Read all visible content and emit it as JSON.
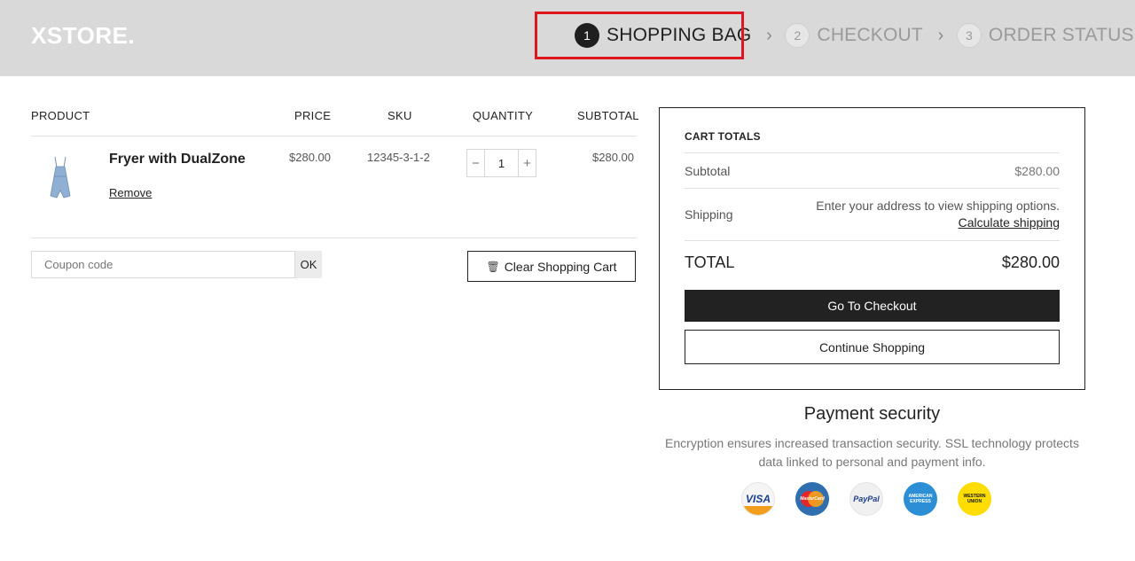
{
  "brand": {
    "logo": "XSTORE."
  },
  "steps": [
    {
      "num": "1",
      "label": "SHOPPING BAG",
      "active": true
    },
    {
      "num": "2",
      "label": "CHECKOUT",
      "active": false
    },
    {
      "num": "3",
      "label": "ORDER STATUS",
      "active": false
    }
  ],
  "cart": {
    "columns": {
      "product": "PRODUCT",
      "price": "PRICE",
      "sku": "SKU",
      "quantity": "QUANTITY",
      "subtotal": "SUBTOTAL"
    },
    "items": [
      {
        "name": "Fryer with DualZone",
        "remove": "Remove",
        "price": "$280.00",
        "sku": "12345-3-1-2",
        "quantity": "1",
        "subtotal": "$280.00"
      }
    ],
    "coupon_placeholder": "Coupon code",
    "coupon_ok": "OK",
    "clear_label": "Clear Shopping Cart"
  },
  "totals": {
    "title": "CART TOTALS",
    "subtotal_label": "Subtotal",
    "subtotal_value": "$280.00",
    "shipping_label": "Shipping",
    "shipping_note": "Enter your address to view shipping options.",
    "calculate_shipping": "Calculate shipping",
    "total_label": "TOTAL",
    "total_value": "$280.00",
    "checkout_label": "Go To Checkout",
    "continue_label": "Continue Shopping"
  },
  "payment": {
    "title": "Payment security",
    "description": "Encryption ensures increased transaction security. SSL technology protects data linked to personal and payment info.",
    "icons": {
      "visa": "VISA",
      "mastercard": "MasterCard",
      "paypal": "PayPal",
      "amex_line1": "AMERICAN",
      "amex_line2": "EXPRESS",
      "wu_line1": "WESTERN",
      "wu_line2": "UNION"
    }
  },
  "colors": {
    "header_bg": "#d9d9d9",
    "highlight": "#e0161f",
    "dark": "#222222"
  }
}
